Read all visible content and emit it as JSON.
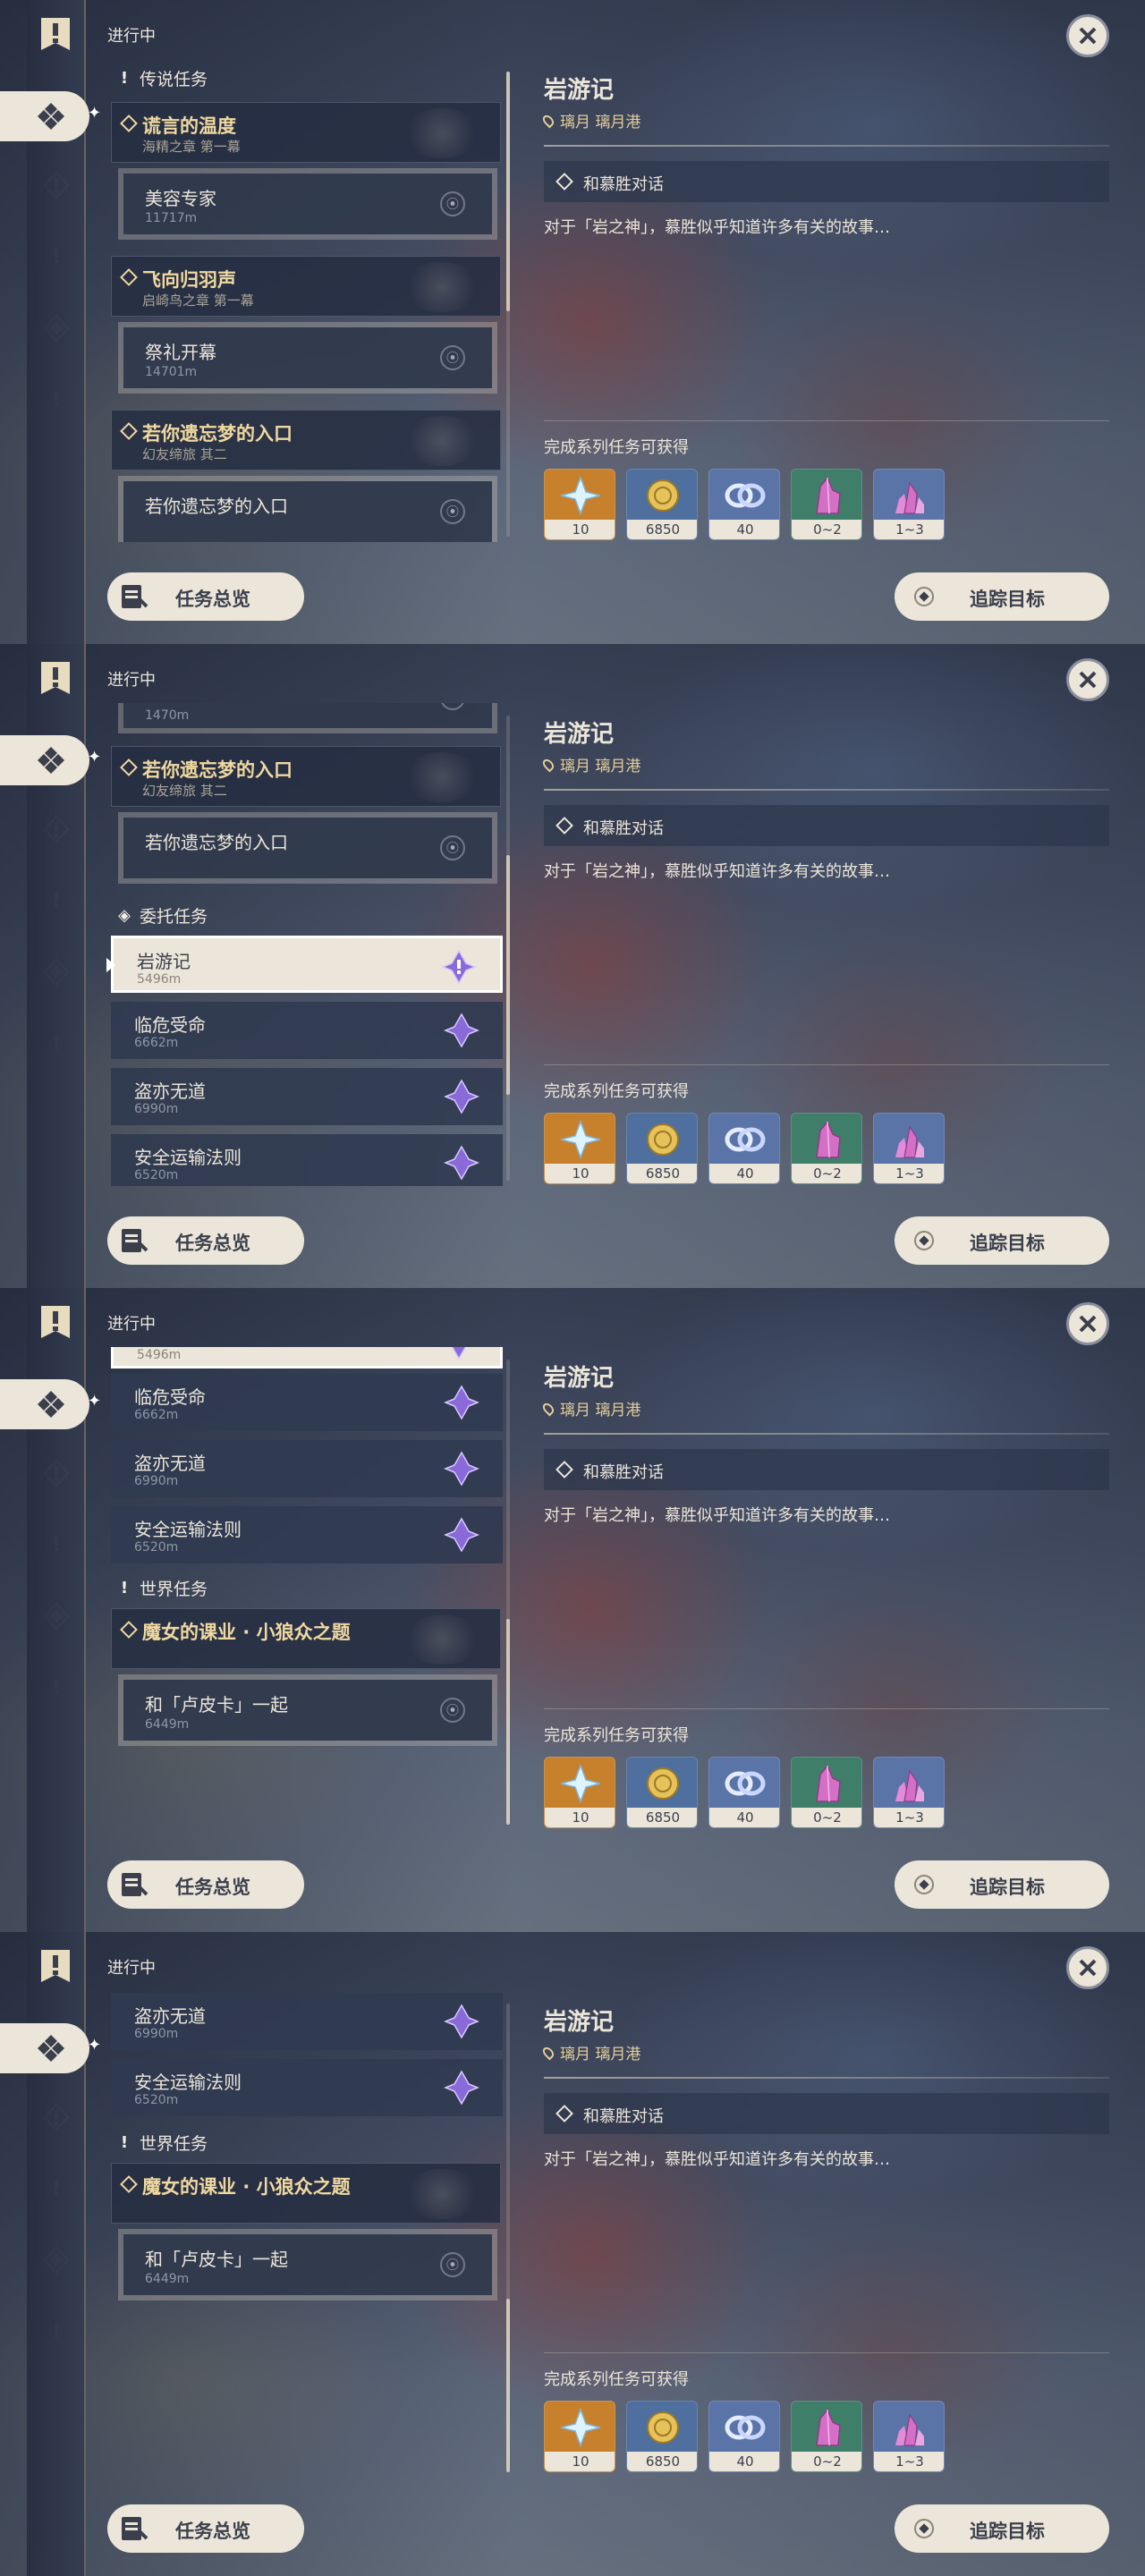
{
  "header": {
    "status": "进行中"
  },
  "quest_detail": {
    "title": "岩游记",
    "location": "璃月 璃月港",
    "objective": "和慕胜对话",
    "description": "对于「岩之神」，慕胜似乎知道许多有关的故事…",
    "rewards_title": "完成系列任务可获得",
    "rewards": [
      {
        "icon": "primogem-icon",
        "amount": "10",
        "color": "#c7812c"
      },
      {
        "icon": "mora-icon",
        "amount": "6850",
        "color": "#4f6f9e"
      },
      {
        "icon": "companionship-exp-icon",
        "amount": "40",
        "color": "#5a74a8"
      },
      {
        "icon": "crystal-chunk-icon",
        "amount": "0~2",
        "color": "#3f7f6a"
      },
      {
        "icon": "crystal-shard-icon",
        "amount": "1~3",
        "color": "#5a74a8"
      }
    ]
  },
  "buttons": {
    "overview": "任务总览",
    "track": "追踪目标"
  },
  "sections": {
    "archon": "传说任务",
    "commission": "委托任务",
    "world": "世界任务"
  },
  "archon_quests": [
    {
      "title": "谎言的温度",
      "chapter": "海精之章 第一幕",
      "sub": "美容专家",
      "dist": "11717m"
    },
    {
      "title": "飞向归羽声",
      "chapter": "启崎鸟之章 第一幕",
      "sub": "祭礼开幕",
      "dist": "14701m"
    },
    {
      "title": "若你遗忘梦的入口",
      "chapter": "幻友缔旅 其二",
      "sub": "若你遗忘梦的入口",
      "dist": ""
    }
  ],
  "commissions": [
    {
      "title": "岩游记",
      "dist": "5496m"
    },
    {
      "title": "临危受命",
      "dist": "6662m"
    },
    {
      "title": "盗亦无道",
      "dist": "6990m"
    },
    {
      "title": "安全运输法则",
      "dist": "6520m"
    }
  ],
  "world_quests": [
    {
      "title": "魔女的课业 · 小狼众之题",
      "sub": "和「卢皮卡」一起",
      "dist": "6449m"
    }
  ],
  "partial_dist": "1470m"
}
